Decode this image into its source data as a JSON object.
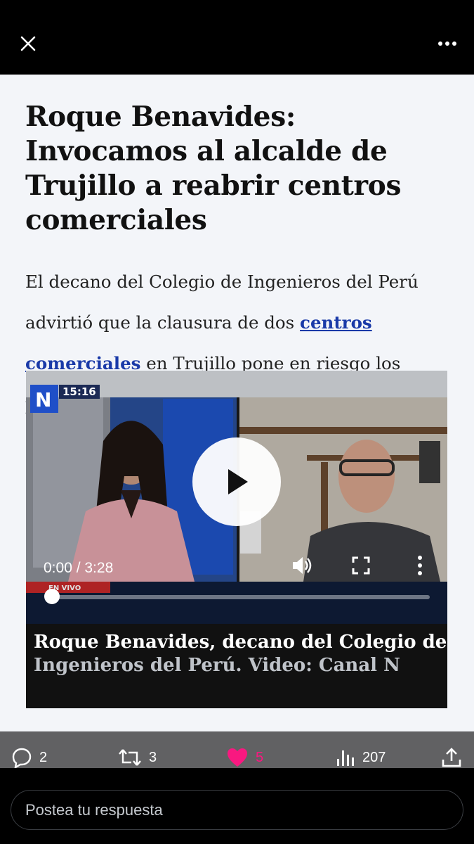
{
  "article": {
    "headline": "Roque Benavides: Invocamos al alcalde de Trujillo a reabrir centros comerciales",
    "lead_before": "El decano del Colegio de Ingenieros del Perú advirtió que la clausura de dos ",
    "lead_link": "centros comerciales",
    "lead_after": " en Trujillo pone en riesgo los puestos de trabajo de miles de personas"
  },
  "video": {
    "clock": "15:16",
    "time": "0:00 / 3:28",
    "progress": 0,
    "caption_line1": "Roque Benavides, decano del Colegio de",
    "caption_line2": "Ingenieros del Perú. Video: Canal N"
  },
  "actions": {
    "replies": "2",
    "reposts": "3",
    "likes": "5",
    "views": "207",
    "like_color": "#f91880"
  },
  "reply": {
    "placeholder": "Postea tu respuesta"
  }
}
